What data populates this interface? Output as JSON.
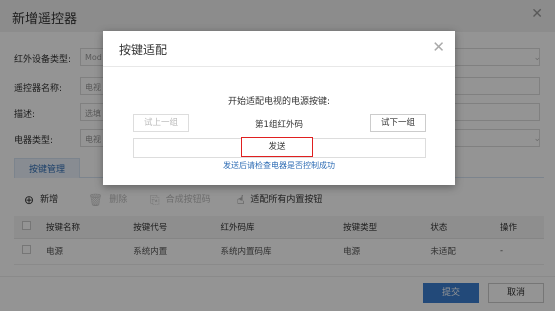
{
  "background": {
    "title": "新增遥控器",
    "fields": [
      {
        "label": "红外设备类型:",
        "value": "Mod"
      },
      {
        "label": "遥控器名称:",
        "value": "电视"
      },
      {
        "label": "描述:",
        "value": "选填"
      },
      {
        "label": "电器类型:",
        "value": "电视"
      }
    ],
    "tab_label": "按键管理",
    "toolbar": {
      "add": "新增",
      "delete": "删除",
      "compose": "合成按钮码",
      "adapt_all": "适配所有内置按钮"
    },
    "table": {
      "headers": [
        "按键名称",
        "按键代号",
        "红外码库",
        "按键类型",
        "状态",
        "操作"
      ],
      "rows": [
        [
          "电源",
          "系统内置",
          "系统内置码库",
          "电源",
          "未适配",
          "-"
        ]
      ]
    },
    "submit": "提交",
    "cancel": "取消"
  },
  "modal": {
    "title": "按键适配",
    "prompt": "开始适配电视的电源按键:",
    "prev_label": "试上一组",
    "code_label": "第1组红外码",
    "next_label": "试下一组",
    "send_label": "发送",
    "hint": "发送后请检查电器是否控制成功"
  },
  "colors": {
    "accent": "#3b7fd1",
    "send_border": "#e02020",
    "hint": "#2f6db5"
  }
}
